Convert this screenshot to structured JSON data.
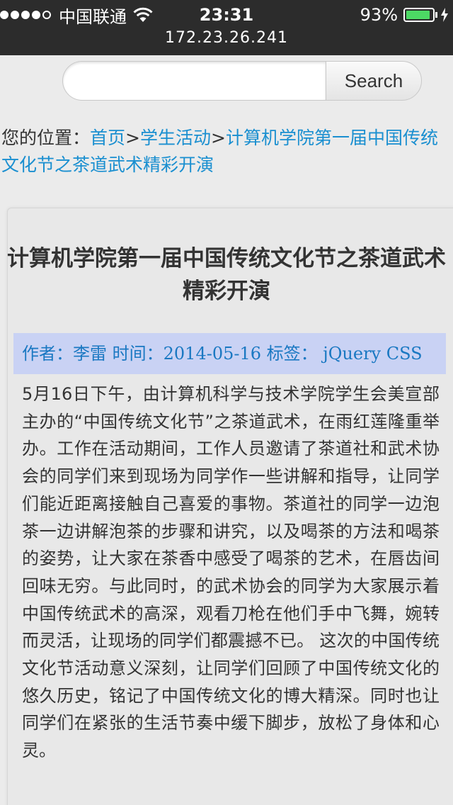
{
  "status_bar": {
    "carrier": "中国联通",
    "time": "23:31",
    "battery_percent": "93%",
    "battery_level": 0.93,
    "battery_color": "#4cd964",
    "signal_bars_filled": 4,
    "signal_bars_total": 5,
    "icons": [
      "wifi-icon",
      "battery-icon",
      "charging-icon"
    ]
  },
  "browser": {
    "url": "172.23.26.241"
  },
  "search": {
    "value": "",
    "placeholder": "",
    "button_label": "Search"
  },
  "breadcrumb": {
    "prefix": "您的位置：",
    "items": [
      "首页",
      "学生活动",
      "计算机学院第一届中国传统文化节之茶道武术精彩开演"
    ],
    "separator": ">"
  },
  "article": {
    "title": "计算机学院第一届中国传统文化节之茶道武术精彩开演",
    "meta": {
      "author_label": "作者：",
      "author": "李雷",
      "time_label": "时间：",
      "date": "2014-05-16",
      "tags_label": "标签：",
      "tags": "jQuery CSS"
    },
    "body": "5月16日下午，由计算机科学与技术学院学生会美宣部主办的“中国传统文化节”之茶道武术，在雨红莲隆重举办。工作在活动期间，工作人员邀请了茶道社和武术协会的同学们来到现场为同学作一些讲解和指导，让同学们能近距离接触自己喜爱的事物。茶道社的同学一边泡茶一边讲解泡茶的步骤和讲究，以及喝茶的方法和喝茶的姿势，让大家在茶香中感受了喝茶的艺术，在唇齿间回味无穷。与此同时，的武术协会的同学为大家展示着中国传统武术的高深，观看刀枪在他们手中飞舞，婉转而灵活，让现场的同学们都震撼不已。 这次的中国传统文化节活动意义深刻，让同学们回顾了中国传统文化的悠久历史，铭记了中国传统文化的博大精深。同时也让同学们在紧张的生活节奏中缓下脚步，放松了身体和心灵。"
  },
  "colors": {
    "link": "#1a8fd0",
    "meta_background": "#c9d2f4",
    "meta_text": "#1a78c2",
    "status_bar": "#2c2c2c",
    "page_background": "#ebebeb"
  }
}
